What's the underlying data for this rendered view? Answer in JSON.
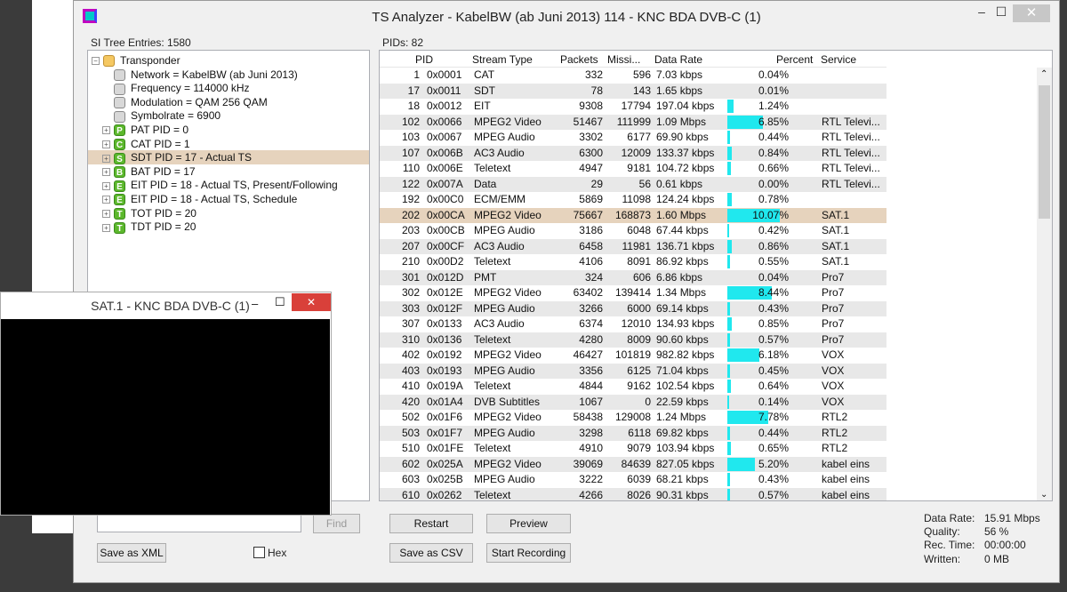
{
  "window": {
    "title": "TS Analyzer - KabelBW (ab Juni 2013) 114 - KNC BDA DVB-C (1)",
    "minimize": "–",
    "maximize": "☐",
    "close": "✕"
  },
  "tree": {
    "label": "SI Tree Entries: 1580",
    "nodes": [
      {
        "text": "Transponder",
        "level": 0,
        "icon": "folder",
        "expander": "−"
      },
      {
        "text": "Network = KabelBW (ab Juni 2013)",
        "level": 1,
        "icon": "gray"
      },
      {
        "text": "Frequency = 114000 kHz",
        "level": 1,
        "icon": "gray"
      },
      {
        "text": "Modulation = QAM 256 QAM",
        "level": 1,
        "icon": "gray"
      },
      {
        "text": "Symbolrate = 6900",
        "level": 1,
        "icon": "gray"
      },
      {
        "text": "PAT PID = 0",
        "level": 1,
        "icon": "green",
        "letter": "P",
        "expander": "+"
      },
      {
        "text": "CAT PID = 1",
        "level": 1,
        "icon": "green",
        "letter": "C",
        "expander": "+"
      },
      {
        "text": "SDT PID = 17 - Actual TS",
        "level": 1,
        "icon": "green",
        "letter": "S",
        "expander": "+",
        "selected": true
      },
      {
        "text": "BAT PID = 17",
        "level": 1,
        "icon": "green",
        "letter": "B",
        "expander": "+"
      },
      {
        "text": "EIT PID = 18 - Actual TS, Present/Following",
        "level": 1,
        "icon": "green",
        "letter": "E",
        "expander": "+"
      },
      {
        "text": "EIT PID = 18 - Actual TS, Schedule",
        "level": 1,
        "icon": "green",
        "letter": "E",
        "expander": "+"
      },
      {
        "text": "TOT PID = 20",
        "level": 1,
        "icon": "green",
        "letter": "T",
        "expander": "+"
      },
      {
        "text": "TDT PID = 20",
        "level": 1,
        "icon": "green",
        "letter": "T",
        "expander": "+"
      }
    ],
    "find_button": "Find",
    "save_xml": "Save as XML",
    "hex_label": "Hex"
  },
  "pids": {
    "label": "PIDs: 82",
    "columns": [
      "PID",
      "Stream Type",
      "Packets",
      "Missi...",
      "Data Rate",
      "Percent",
      "Service"
    ],
    "rows": [
      [
        "1",
        "0x0001",
        "CAT",
        "332",
        "596",
        "7.03 kbps",
        "0.04%",
        ""
      ],
      [
        "17",
        "0x0011",
        "SDT",
        "78",
        "143",
        "1.65 kbps",
        "0.01%",
        ""
      ],
      [
        "18",
        "0x0012",
        "EIT",
        "9308",
        "17794",
        "197.04 kbps",
        "1.24%",
        ""
      ],
      [
        "102",
        "0x0066",
        "MPEG2 Video",
        "51467",
        "111999",
        "1.09 Mbps",
        "6.85%",
        "RTL Televi..."
      ],
      [
        "103",
        "0x0067",
        "MPEG Audio",
        "3302",
        "6177",
        "69.90 kbps",
        "0.44%",
        "RTL Televi..."
      ],
      [
        "107",
        "0x006B",
        "AC3 Audio",
        "6300",
        "12009",
        "133.37 kbps",
        "0.84%",
        "RTL Televi..."
      ],
      [
        "110",
        "0x006E",
        "Teletext",
        "4947",
        "9181",
        "104.72 kbps",
        "0.66%",
        "RTL Televi..."
      ],
      [
        "122",
        "0x007A",
        "Data",
        "29",
        "56",
        "0.61 kbps",
        "0.00%",
        "RTL Televi..."
      ],
      [
        "192",
        "0x00C0",
        "ECM/EMM",
        "5869",
        "11098",
        "124.24 kbps",
        "0.78%",
        ""
      ],
      [
        "202",
        "0x00CA",
        "MPEG2 Video",
        "75667",
        "168873",
        "1.60 Mbps",
        "10.07%",
        "SAT.1"
      ],
      [
        "203",
        "0x00CB",
        "MPEG Audio",
        "3186",
        "6048",
        "67.44 kbps",
        "0.42%",
        "SAT.1"
      ],
      [
        "207",
        "0x00CF",
        "AC3 Audio",
        "6458",
        "11981",
        "136.71 kbps",
        "0.86%",
        "SAT.1"
      ],
      [
        "210",
        "0x00D2",
        "Teletext",
        "4106",
        "8091",
        "86.92 kbps",
        "0.55%",
        "SAT.1"
      ],
      [
        "301",
        "0x012D",
        "PMT",
        "324",
        "606",
        "6.86 kbps",
        "0.04%",
        "Pro7"
      ],
      [
        "302",
        "0x012E",
        "MPEG2 Video",
        "63402",
        "139414",
        "1.34 Mbps",
        "8.44%",
        "Pro7"
      ],
      [
        "303",
        "0x012F",
        "MPEG Audio",
        "3266",
        "6000",
        "69.14 kbps",
        "0.43%",
        "Pro7"
      ],
      [
        "307",
        "0x0133",
        "AC3 Audio",
        "6374",
        "12010",
        "134.93 kbps",
        "0.85%",
        "Pro7"
      ],
      [
        "310",
        "0x0136",
        "Teletext",
        "4280",
        "8009",
        "90.60 kbps",
        "0.57%",
        "Pro7"
      ],
      [
        "402",
        "0x0192",
        "MPEG2 Video",
        "46427",
        "101819",
        "982.82 kbps",
        "6.18%",
        "VOX"
      ],
      [
        "403",
        "0x0193",
        "MPEG Audio",
        "3356",
        "6125",
        "71.04 kbps",
        "0.45%",
        "VOX"
      ],
      [
        "410",
        "0x019A",
        "Teletext",
        "4844",
        "9162",
        "102.54 kbps",
        "0.64%",
        "VOX"
      ],
      [
        "420",
        "0x01A4",
        "DVB Subtitles",
        "1067",
        "0",
        "22.59 kbps",
        "0.14%",
        "VOX"
      ],
      [
        "502",
        "0x01F6",
        "MPEG2 Video",
        "58438",
        "129008",
        "1.24 Mbps",
        "7.78%",
        "RTL2"
      ],
      [
        "503",
        "0x01F7",
        "MPEG Audio",
        "3298",
        "6118",
        "69.82 kbps",
        "0.44%",
        "RTL2"
      ],
      [
        "510",
        "0x01FE",
        "Teletext",
        "4910",
        "9079",
        "103.94 kbps",
        "0.65%",
        "RTL2"
      ],
      [
        "602",
        "0x025A",
        "MPEG2 Video",
        "39069",
        "84639",
        "827.05 kbps",
        "5.20%",
        "kabel eins"
      ],
      [
        "603",
        "0x025B",
        "MPEG Audio",
        "3222",
        "6039",
        "68.21 kbps",
        "0.43%",
        "kabel eins"
      ],
      [
        "610",
        "0x0262",
        "Teletext",
        "4266",
        "8026",
        "90.31 kbps",
        "0.57%",
        "kabel eins"
      ]
    ],
    "selected_pid": "202",
    "bar_color": "#20e8ee"
  },
  "buttons": {
    "restart": "Restart",
    "preview": "Preview",
    "save_csv": "Save as CSV",
    "start_recording": "Start Recording"
  },
  "stats": {
    "data_rate_label": "Data Rate:",
    "data_rate": "15.91 Mbps",
    "quality_label": "Quality:",
    "quality": "56 %",
    "rec_time_label": "Rec. Time:",
    "rec_time": "00:00:00",
    "written_label": "Written:",
    "written": "0 MB"
  },
  "popup": {
    "title": "SAT.1 - KNC BDA DVB-C (1)",
    "minimize": "–",
    "maximize": "☐",
    "close": "✕"
  }
}
